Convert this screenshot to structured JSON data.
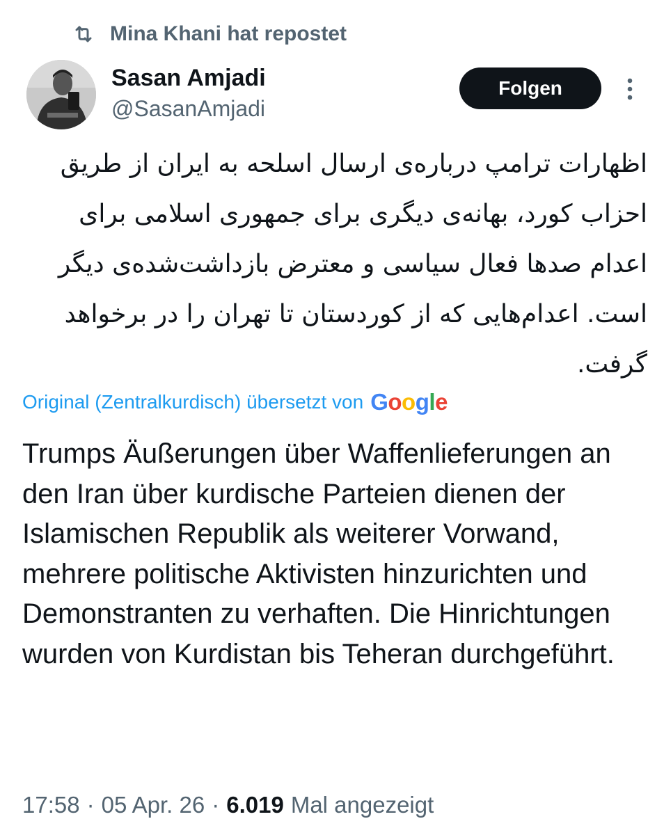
{
  "repost": {
    "icon": "repost-icon",
    "text": "Mina Khani hat repostet"
  },
  "author": {
    "avatar": "avatar",
    "name": "Sasan Amjadi",
    "handle": "@SasanAmjadi"
  },
  "follow_button": {
    "label": "Folgen"
  },
  "more_button": {
    "icon": "more-vertical-icon"
  },
  "post": {
    "original_text": "اظهارات ترامپ درباره‌ی ارسال اسلحه به ایران از طریق احزاب کورد، بهانه‌ی دیگری برای جمهوری اسلامی برای اعدام صدها فعال سیاسی و معترض بازداشت‌شده‌ی دیگر است. اعدام‌هایی که از کوردستان تا تهران را در برخواهد گرفت.",
    "translation_note": "Original (Zentralkurdisch) übersetzt von",
    "google_logo_text": "Google",
    "google_colors": [
      "#4285F4",
      "#EA4335",
      "#FBBC05",
      "#4285F4",
      "#34A853",
      "#EA4335"
    ],
    "translated_text": "Trumps Äußerungen über Waffenlieferungen an den Iran über kurdische Parteien dienen der Islamischen Republik als weiterer Vorwand, mehrere politische Aktivisten hinzurichten und Demonstranten zu verhaften. Die Hinrichtungen wurden von Kurdistan bis Teheran durchgeführt."
  },
  "meta": {
    "time": "17:58",
    "separator": "·",
    "date": "05 Apr. 26",
    "views_count": "6.019",
    "views_label": "Mal angezeigt"
  },
  "colors": {
    "text_primary": "#0f1419",
    "text_secondary": "#536471",
    "link_blue": "#1d9bf0",
    "button_bg": "#0f1419",
    "button_text": "#ffffff"
  }
}
